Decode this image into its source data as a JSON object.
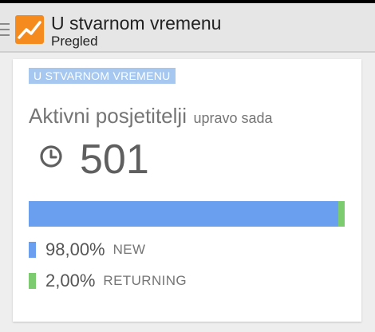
{
  "colors": {
    "new": "#6a9ff0",
    "returning": "#7dcb6f",
    "tag_bg": "#a6c8f0",
    "logo_orange": "#f58a1f"
  },
  "app_bar": {
    "menu_icon": "hamburger-icon",
    "logo_icon": "analytics-logo-icon",
    "title": "U stvarnom vremenu",
    "subtitle": "Pregled"
  },
  "card": {
    "tag": "U STVARNOM VREMENU",
    "metric_label": "Aktivni posjetitelji",
    "metric_sub": "upravo sada",
    "clock_icon": "clock-icon",
    "count": "501",
    "segments": [
      {
        "name": "NEW",
        "percent_label": "98,00%",
        "fraction": 0.98,
        "color": "#6a9ff0"
      },
      {
        "name": "RETURNING",
        "percent_label": "2,00%",
        "fraction": 0.02,
        "color": "#7dcb6f"
      }
    ]
  }
}
